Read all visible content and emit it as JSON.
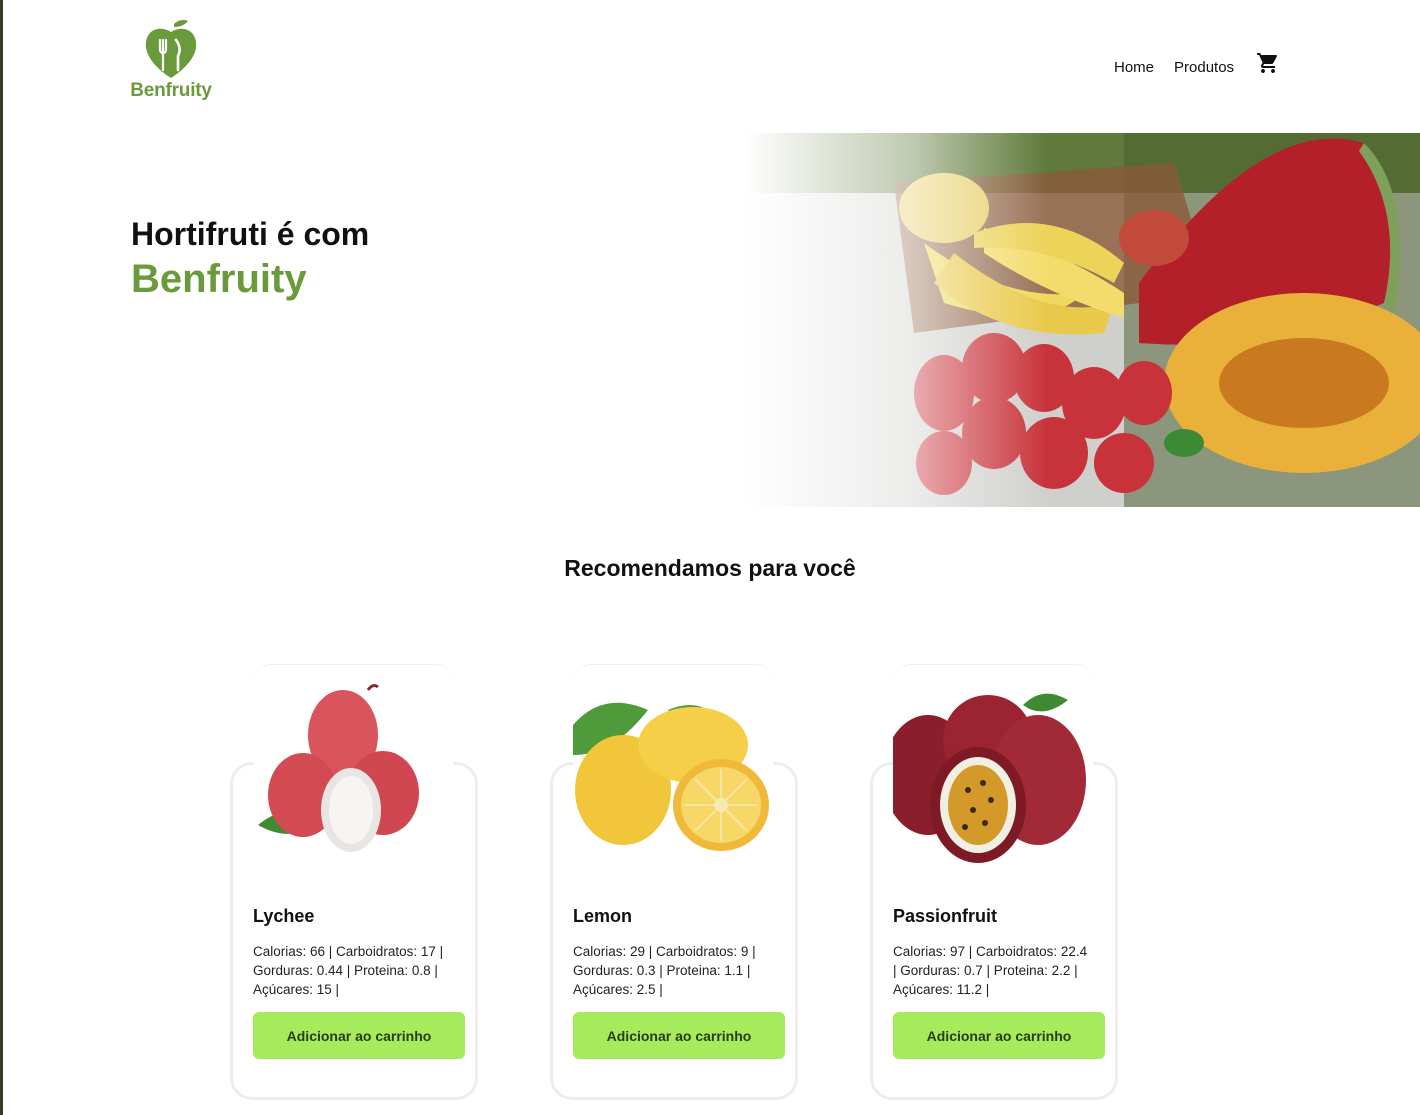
{
  "brand": {
    "name": "Benfruity",
    "accent_color": "#6b9a3c"
  },
  "nav": {
    "home": "Home",
    "products": "Produtos",
    "cart_icon": "shopping-cart-icon"
  },
  "hero": {
    "line1": "Hortifruti é com",
    "line2": "Benfruity"
  },
  "recommended": {
    "title": "Recomendamos para você",
    "button_color": "#a6eb5c",
    "products": [
      {
        "name": "Lychee",
        "info": "Calorias: 66 | Carboidratos: 17 | Gorduras: 0.44 | Proteina: 0.8 | Açúcares: 15 |",
        "button": "Adicionar ao carrinho"
      },
      {
        "name": "Lemon",
        "info": "Calorias: 29 | Carboidratos: 9 | Gorduras: 0.3 | Proteina: 1.1 | Açúcares: 2.5 |",
        "button": "Adicionar ao carrinho"
      },
      {
        "name": "Passionfruit",
        "info": "Calorias: 97 | Carboidratos: 22.4 | Gorduras: 0.7 | Proteina: 2.2 | Açúcares: 11.2 |",
        "button": "Adicionar ao carrinho"
      }
    ]
  }
}
